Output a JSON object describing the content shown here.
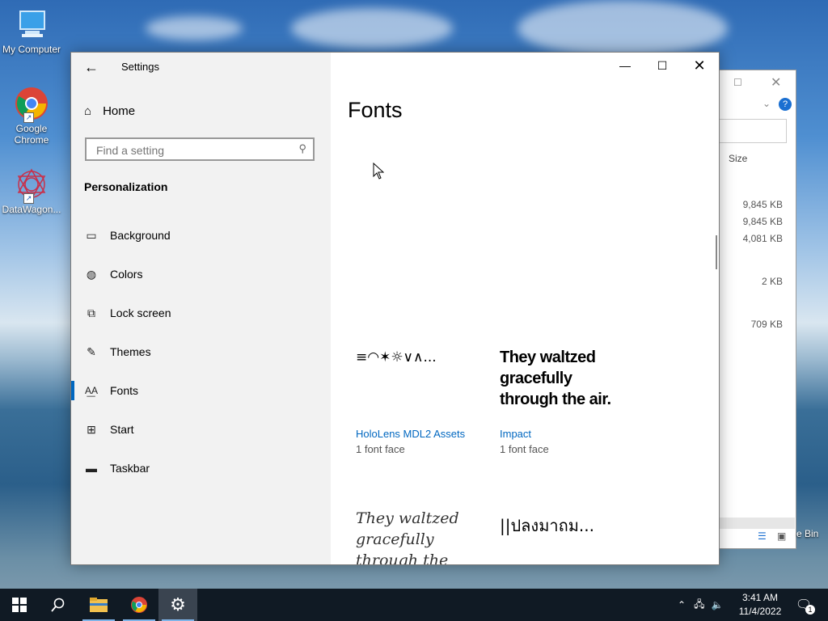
{
  "desktop": {
    "icons": [
      {
        "label": "My Computer"
      },
      {
        "label": "Google Chrome"
      },
      {
        "label": "DataWagon..."
      }
    ],
    "recycle_bin_label": "e Bin"
  },
  "explorer_bg": {
    "size_header": "Size",
    "rows": [
      "9,845 KB",
      "9,845 KB",
      "4,081 KB",
      "2 KB",
      "709 KB"
    ]
  },
  "settings": {
    "window_title": "Settings",
    "home_label": "Home",
    "search_placeholder": "Find a setting",
    "section_label": "Personalization",
    "nav": [
      {
        "label": "Background",
        "icon": "image-icon"
      },
      {
        "label": "Colors",
        "icon": "palette-icon"
      },
      {
        "label": "Lock screen",
        "icon": "lock-screen-icon"
      },
      {
        "label": "Themes",
        "icon": "themes-icon"
      },
      {
        "label": "Fonts",
        "icon": "fonts-icon",
        "active": true
      },
      {
        "label": "Start",
        "icon": "start-icon"
      },
      {
        "label": "Taskbar",
        "icon": "taskbar-icon"
      }
    ],
    "page_title": "Fonts",
    "fonts": [
      {
        "preview": "≡◠✶☼∨∧...",
        "name": "HoloLens MDL2 Assets",
        "faces": "1 font face"
      },
      {
        "preview": "They waltzed gracefully through the air.",
        "name": "Impact",
        "faces": "1 font face"
      },
      {
        "preview": "They waltzed gracefully through the air.",
        "name": "",
        "faces": ""
      },
      {
        "preview": "||ปลงมาถม...",
        "name": "",
        "faces": ""
      }
    ]
  },
  "taskbar": {
    "time": "3:41 AM",
    "date": "11/4/2022",
    "notification_count": "1"
  },
  "colors": {
    "accent": "#0067c0",
    "sidebar_bg": "#f2f2f2",
    "taskbar_bg": "#101a24"
  }
}
